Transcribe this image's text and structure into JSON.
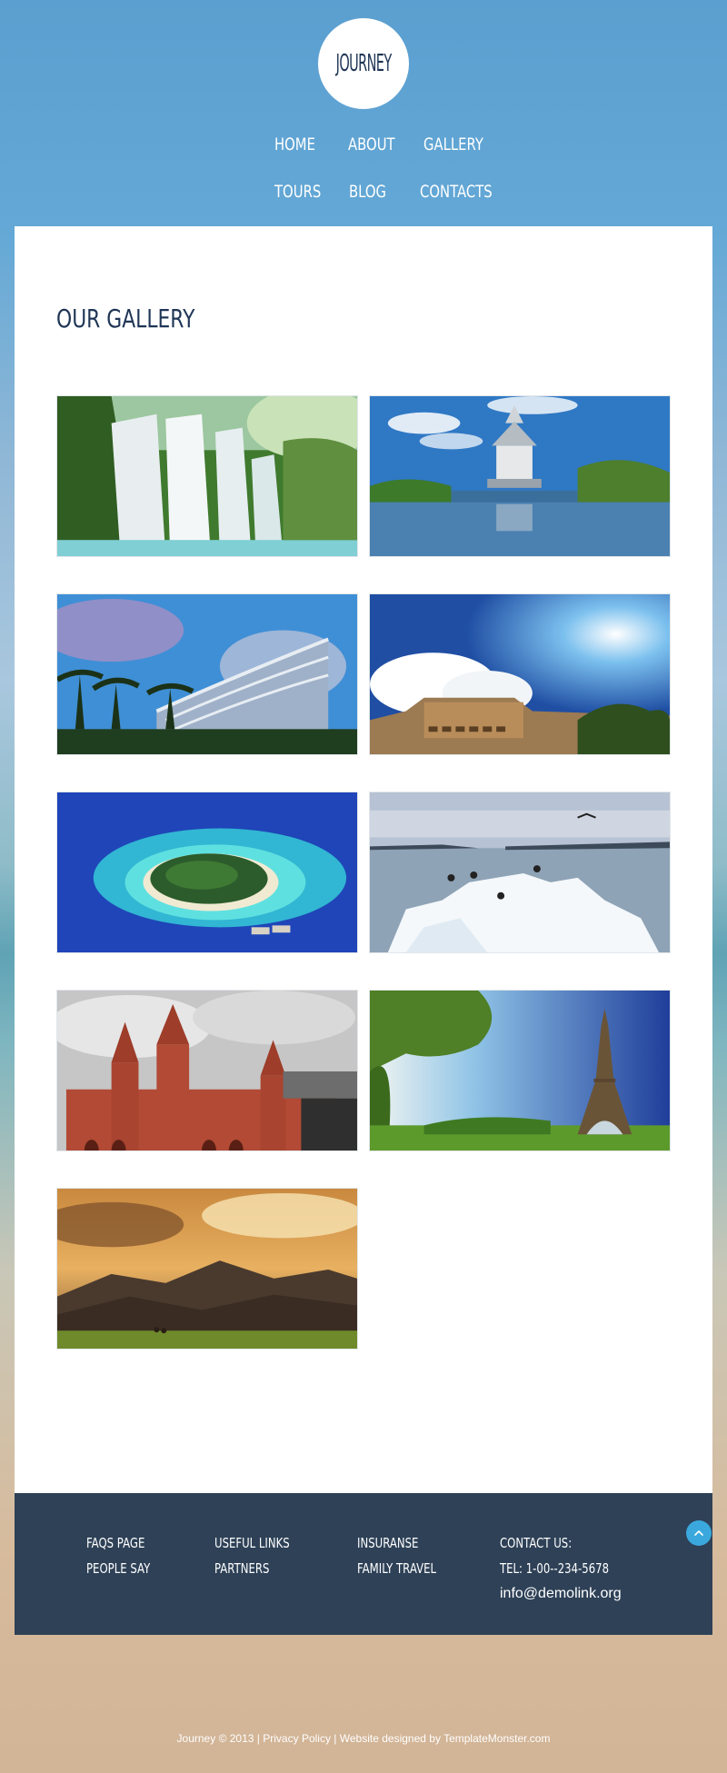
{
  "header": {
    "logo_text": "JOURNEY",
    "nav": [
      {
        "label": "HOME"
      },
      {
        "label": "ABOUT"
      },
      {
        "label": "GALLERY"
      },
      {
        "label": "TOURS"
      },
      {
        "label": "BLOG"
      },
      {
        "label": "CONTACTS"
      }
    ]
  },
  "main": {
    "title": "OUR GALLERY"
  },
  "footer": {
    "col1": [
      "FAQS PAGE",
      "PEOPLE SAY"
    ],
    "col2": [
      "USEFUL LINKS",
      "PARTNERS"
    ],
    "col3": [
      "INSURANSE",
      "FAMILY TRAVEL"
    ],
    "contact_label": "CONTACT US:",
    "tel": "TEL: 1-00--234-5678",
    "email": "info@demolink.org"
  },
  "copyright": {
    "brand": "Journey",
    "year": "© 2013",
    "sep1": "|",
    "privacy": "Privacy Policy",
    "sep2": "|",
    "designed_by": "Website designed by",
    "designer": "TemplateMonster.com"
  },
  "icons": {
    "back_to_top": "chevron-up-icon"
  },
  "colors": {
    "navy": "#1f3556",
    "footer_bg": "#2e4157",
    "accent": "#3aa8dc"
  }
}
